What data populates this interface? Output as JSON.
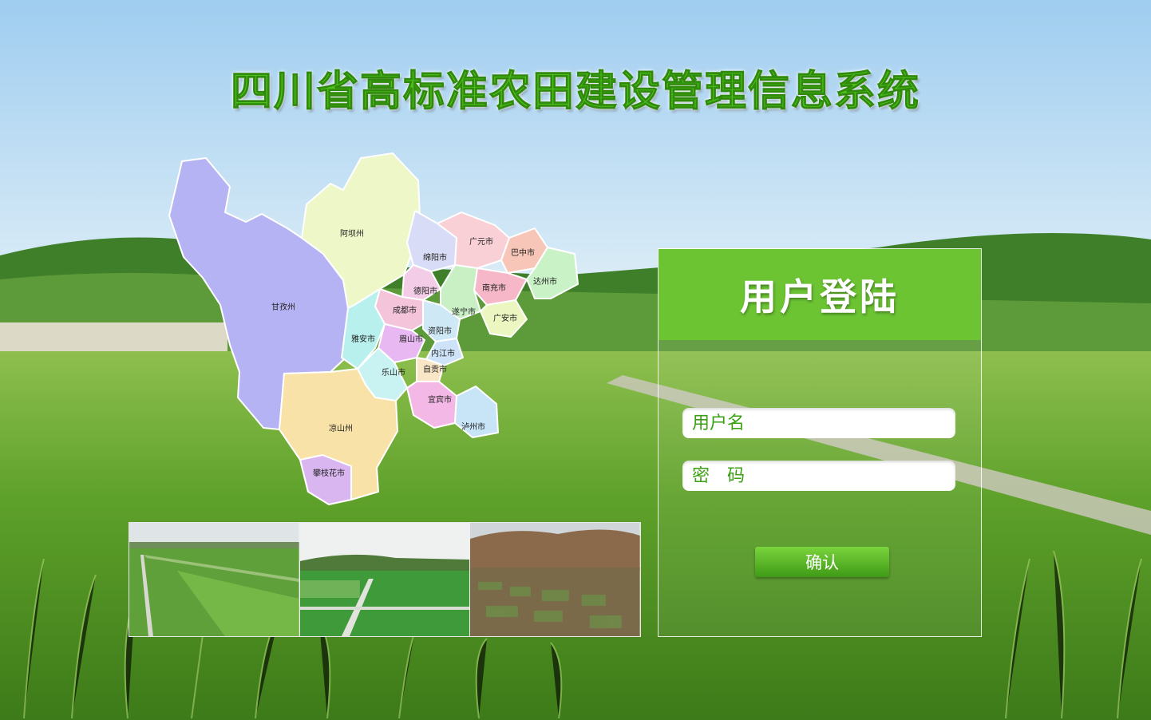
{
  "app": {
    "title": "四川省高标准农田建设管理信息系统"
  },
  "map": {
    "regions": [
      {
        "name": "甘孜州",
        "color": "#b6b3f4"
      },
      {
        "name": "阿坝州",
        "color": "#eef7c8"
      },
      {
        "name": "绵阳市",
        "color": "#d9dcf6"
      },
      {
        "name": "广元市",
        "color": "#f8d0d6"
      },
      {
        "name": "巴中市",
        "color": "#f7c6b8"
      },
      {
        "name": "达州市",
        "color": "#c9f2c6"
      },
      {
        "name": "南充市",
        "color": "#f6b8c9"
      },
      {
        "name": "德阳市",
        "color": "#f3cde8"
      },
      {
        "name": "成都市",
        "color": "#f4c4da"
      },
      {
        "name": "遂宁市",
        "color": "#c9f0c5"
      },
      {
        "name": "广安市",
        "color": "#ecf6c0"
      },
      {
        "name": "资阳市",
        "color": "#cfe8f6"
      },
      {
        "name": "雅安市",
        "color": "#b8f0ee"
      },
      {
        "name": "眉山市",
        "color": "#e8b8f2"
      },
      {
        "name": "内江市",
        "color": "#cfe3f8"
      },
      {
        "name": "乐山市",
        "color": "#c9f3f2"
      },
      {
        "name": "自贡市",
        "color": "#f8e6c6"
      },
      {
        "name": "宜宾市",
        "color": "#f4b8e6"
      },
      {
        "name": "泸州市",
        "color": "#c8e4f7"
      },
      {
        "name": "凉山州",
        "color": "#f8e2a8"
      },
      {
        "name": "攀枝花市",
        "color": "#d9b6f0"
      }
    ]
  },
  "gallery": {
    "photos": [
      {
        "alt": "rice-field-photo-1"
      },
      {
        "alt": "rice-field-photo-2"
      },
      {
        "alt": "terraced-fields-photo"
      }
    ]
  },
  "login": {
    "heading": "用户登陆",
    "username_placeholder": "用户名",
    "password_placeholder": "密　码",
    "confirm_label": "确认"
  },
  "colors": {
    "accent": "#6cc433",
    "title_green": "#4dbf1c"
  }
}
